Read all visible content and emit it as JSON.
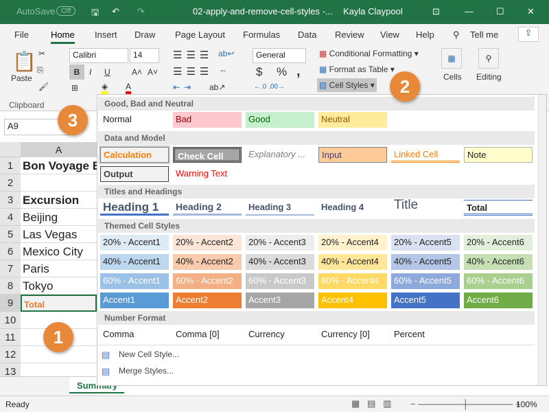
{
  "titlebar": {
    "autosave": "AutoSave",
    "autosave_state": "Off",
    "filename": "02-apply-and-remove-cell-styles  -...",
    "user": "Kayla Claypool"
  },
  "tabs": [
    "File",
    "Home",
    "Insert",
    "Draw",
    "Page Layout",
    "Formulas",
    "Data",
    "Review",
    "View",
    "Help",
    "Tell me"
  ],
  "ribbon": {
    "paste": "Paste",
    "clipboard": "Clipboard",
    "font": "Calibri",
    "size": "14",
    "bold": "B",
    "italic": "I",
    "underline": "U",
    "number_format": "General",
    "currency": "$",
    "percent": "%",
    "comma": ",",
    "conditional": "Conditional Formatting",
    "format_table": "Format as Table",
    "cell_styles": "Cell Styles",
    "cells": "Cells",
    "editing": "Editing",
    "highlight_color": "#ffff00",
    "font_color": "#ff0000"
  },
  "namebox": "A9",
  "column": "A",
  "rows": [
    {
      "n": "1",
      "v": "Bon Voyage E",
      "b": true
    },
    {
      "n": "2",
      "v": ""
    },
    {
      "n": "3",
      "v": "Excursion",
      "b": true
    },
    {
      "n": "4",
      "v": "Beijing"
    },
    {
      "n": "5",
      "v": "Las Vegas"
    },
    {
      "n": "6",
      "v": "Mexico City"
    },
    {
      "n": "7",
      "v": "Paris"
    },
    {
      "n": "8",
      "v": "Tokyo"
    },
    {
      "n": "9",
      "v": "Total"
    },
    {
      "n": "10",
      "v": ""
    },
    {
      "n": "11",
      "v": ""
    },
    {
      "n": "12",
      "v": ""
    },
    {
      "n": "13",
      "v": ""
    }
  ],
  "sheet_tab": "Summary",
  "gallery": {
    "sections": [
      "Good, Bad and Neutral",
      "Data and Model",
      "Titles and Headings",
      "Themed Cell Styles",
      "Number Format"
    ],
    "good_bad": [
      "Normal",
      "Bad",
      "Good",
      "Neutral"
    ],
    "data_model_1": [
      "Calculation",
      "Check Cell",
      "Explanatory ...",
      "Input",
      "Linked Cell",
      "Note"
    ],
    "data_model_2": [
      "Output",
      "Warning Text"
    ],
    "titles": [
      "Heading 1",
      "Heading 2",
      "Heading 3",
      "Heading 4",
      "Title",
      "Total"
    ],
    "themed_20": [
      "20% - Accent1",
      "20% - Accent2",
      "20% - Accent3",
      "20% - Accent4",
      "20% - Accent5",
      "20% - Accent6"
    ],
    "themed_40": [
      "40% - Accent1",
      "40% - Accent2",
      "40% - Accent3",
      "40% - Accent4",
      "40% - Accent5",
      "40% - Accent6"
    ],
    "themed_60": [
      "60% - Accent1",
      "60% - Accent2",
      "60% - Accent3",
      "60% - Accent4",
      "60% - Accent5",
      "60% - Accent6"
    ],
    "themed_100": [
      "Accent1",
      "Accent2",
      "Accent3",
      "Accent4",
      "Accent5",
      "Accent6"
    ],
    "number": [
      "Comma",
      "Comma [0]",
      "Currency",
      "Currency [0]",
      "Percent"
    ],
    "new_style": "New Cell Style...",
    "merge": "Merge Styles...",
    "accent_colors": [
      "#5b9bd5",
      "#ed7d31",
      "#a5a5a5",
      "#ffc000",
      "#4472c4",
      "#70ad47"
    ]
  },
  "callouts": [
    "1",
    "2",
    "3"
  ],
  "status": {
    "ready": "Ready",
    "zoom": "100%"
  }
}
